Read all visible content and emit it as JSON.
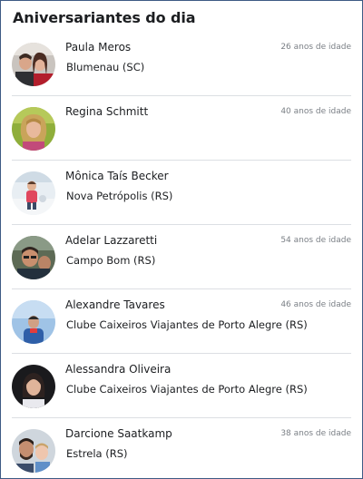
{
  "widget": {
    "title": "Aniversariantes do dia"
  },
  "people": [
    {
      "name": "Paula Meros",
      "city": "Blumenau (SC)",
      "age": "26 anos de idade",
      "avatar": "couple-photo"
    },
    {
      "name": "Regina Schmitt",
      "city": "",
      "age": "40 anos de idade",
      "avatar": "woman-photo"
    },
    {
      "name": "Mônica Taís Becker",
      "city": "Nova Petrópolis (RS)",
      "age": "",
      "avatar": "child-snow-photo"
    },
    {
      "name": "Adelar Lazzaretti",
      "city": "Campo Bom (RS)",
      "age": "54 anos de idade",
      "avatar": "man-selfie-photo"
    },
    {
      "name": "Alexandre Tavares",
      "city": "Clube Caixeiros Viajantes de Porto Alegre (RS)",
      "age": "46 anos de idade",
      "avatar": "man-sky-photo"
    },
    {
      "name": "Alessandra Oliveira",
      "city": "Clube Caixeiros Viajantes de Porto Alegre (RS)",
      "age": "",
      "avatar": "woman-dark-photo"
    },
    {
      "name": "Darcione Saatkamp",
      "city": "Estrela (RS)",
      "age": "38 anos de idade",
      "avatar": "man-child-photo"
    }
  ]
}
